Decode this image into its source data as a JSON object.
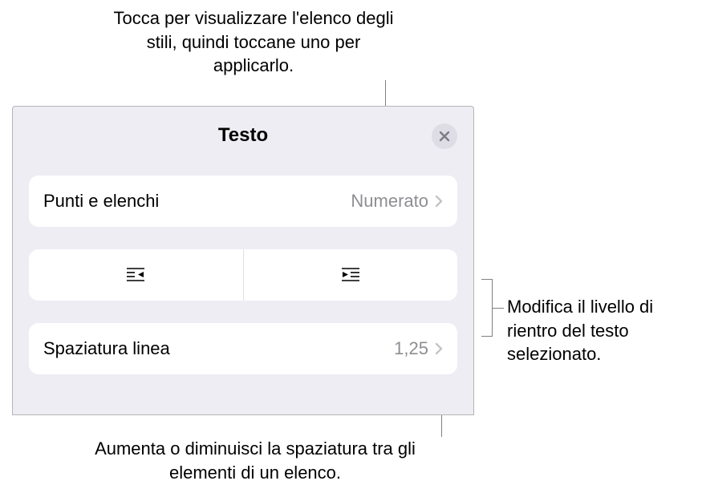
{
  "callouts": {
    "top": "Tocca per visualizzare l'elenco degli stili, quindi toccane uno per applicarlo.",
    "right": "Modifica il livello di rientro del testo selezionato.",
    "bottom": "Aumenta o diminuisci la spaziatura tra gli elementi di un elenco."
  },
  "panel": {
    "title": "Testo",
    "rows": {
      "bullets": {
        "label": "Punti e elenchi",
        "value": "Numerato"
      },
      "spacing": {
        "label": "Spaziatura linea",
        "value": "1,25"
      }
    }
  }
}
